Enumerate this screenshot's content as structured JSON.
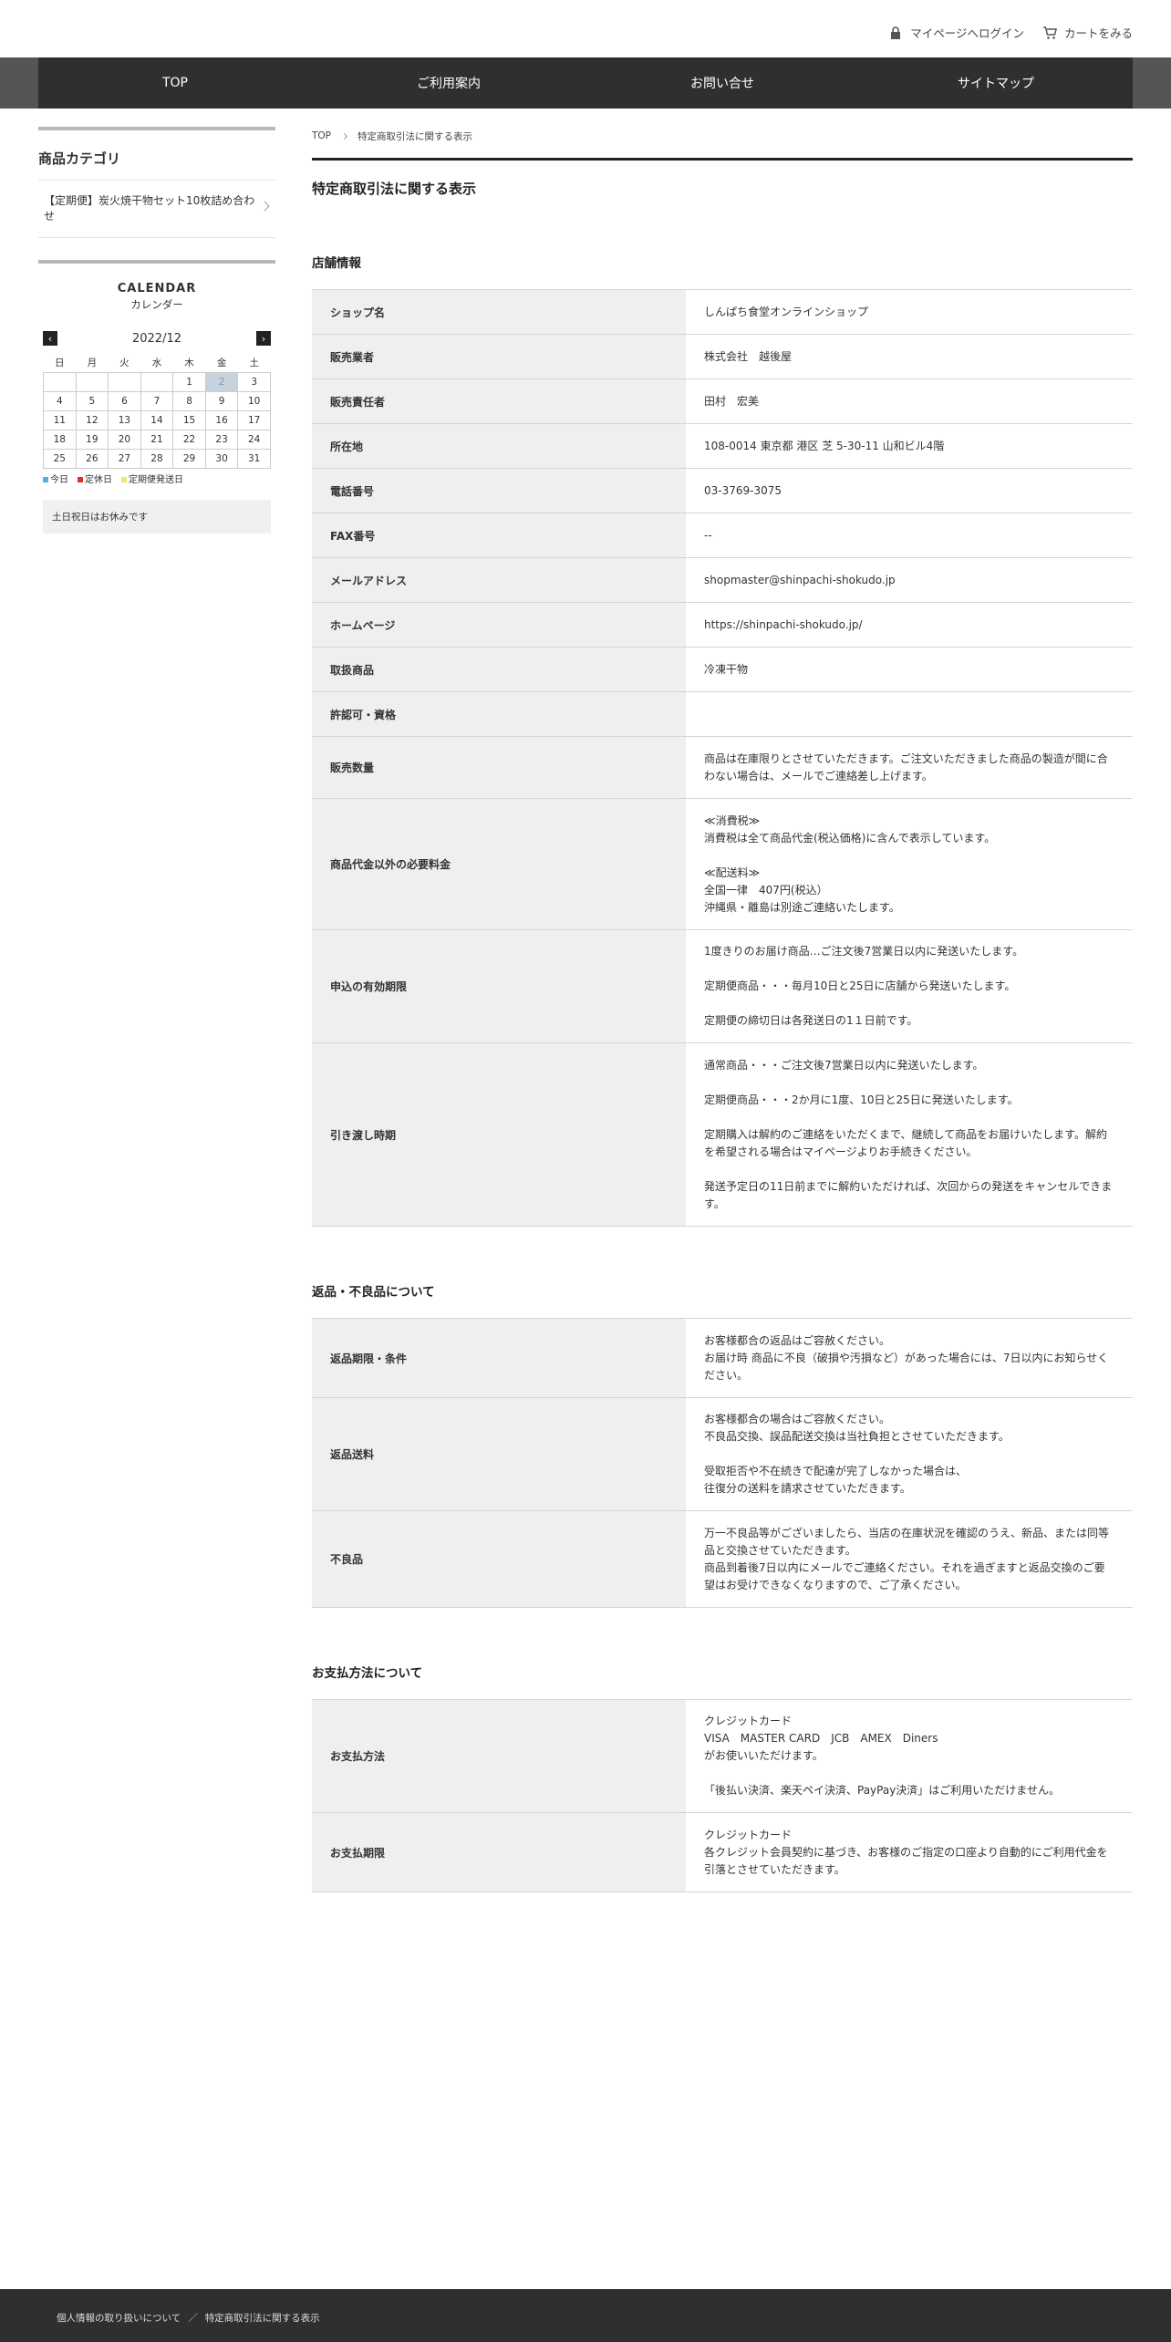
{
  "header": {
    "mypage_label": "マイページへログイン",
    "cart_label": "カートをみる"
  },
  "nav": [
    "TOP",
    "ご利用案内",
    "お問い合せ",
    "サイトマップ"
  ],
  "sidebar": {
    "category_title": "商品カテゴリ",
    "category_item": "【定期便】炭火焼干物セット10枚詰め合わせ",
    "calendar_title": "CALENDAR",
    "calendar_subtitle": "カレンダー",
    "calendar_month": "2022/12",
    "prev_symbol": "‹",
    "next_symbol": "›",
    "weekdays": [
      "日",
      "月",
      "火",
      "水",
      "木",
      "金",
      "土"
    ],
    "weeks": [
      [
        "",
        "",
        "",
        "",
        "1",
        "2",
        "3"
      ],
      [
        "4",
        "5",
        "6",
        "7",
        "8",
        "9",
        "10"
      ],
      [
        "11",
        "12",
        "13",
        "14",
        "15",
        "16",
        "17"
      ],
      [
        "18",
        "19",
        "20",
        "21",
        "22",
        "23",
        "24"
      ],
      [
        "25",
        "26",
        "27",
        "28",
        "29",
        "30",
        "31"
      ]
    ],
    "today": "2",
    "legend": [
      {
        "label": "今日",
        "color": "#4fb3e0"
      },
      {
        "label": "定休日",
        "color": "#e0302a"
      },
      {
        "label": "定期便発送日",
        "color": "#f3e86a"
      }
    ],
    "note": "土日祝日はお休みです"
  },
  "breadcrumb": [
    "TOP",
    "特定商取引法に関する表示"
  ],
  "page_title": "特定商取引法に関する表示",
  "sections": [
    {
      "title": "店舗情報",
      "rows": [
        {
          "label": "ショップ名",
          "value": "しんぱち食堂オンラインショップ"
        },
        {
          "label": "販売業者",
          "value": "株式会社　越後屋"
        },
        {
          "label": "販売責任者",
          "value": "田村　宏美"
        },
        {
          "label": "所在地",
          "value": "108-0014 東京都 港区 芝 5-30-11 山和ビル4階"
        },
        {
          "label": "電話番号",
          "value": "03-3769-3075"
        },
        {
          "label": "FAX番号",
          "value": "--"
        },
        {
          "label": "メールアドレス",
          "value": "shopmaster@shinpachi-shokudo.jp"
        },
        {
          "label": "ホームページ",
          "value": "https://shinpachi-shokudo.jp/"
        },
        {
          "label": "取扱商品",
          "value": "冷凍干物"
        },
        {
          "label": "許認可・資格",
          "value": ""
        },
        {
          "label": "販売数量",
          "value": "商品は在庫限りとさせていただきます。ご注文いただきました商品の製造が間に合わない場合は、メールでご連絡差し上げます。"
        },
        {
          "label": "商品代金以外の必要料金",
          "value": "≪消費税≫\n消費税は全て商品代金(税込価格)に含んで表示しています。\n\n≪配送料≫\n全国一律　407円(税込）\n沖縄県・離島は別途ご連絡いたします。"
        },
        {
          "label": "申込の有効期限",
          "value": "1度きりのお届け商品…ご注文後7営業日以内に発送いたします。\n\n定期便商品・・・毎月10日と25日に店舗から発送いたします。\n\n定期便の締切日は各発送日の1１日前です。"
        },
        {
          "label": "引き渡し時期",
          "value": "通常商品・・・ご注文後7営業日以内に発送いたします。\n\n定期便商品・・・2か月に1度、10日と25日に発送いたします。\n\n定期購入は解約のご連絡をいただくまで、継続して商品をお届けいたします。解約を希望される場合はマイページよりお手続きください。\n\n発送予定日の11日前までに解約いただければ、次回からの発送をキャンセルできます。"
        }
      ]
    },
    {
      "title": "返品・不良品について",
      "rows": [
        {
          "label": "返品期限・条件",
          "value": "お客様都合の返品はご容赦ください。\nお届け時 商品に不良（破損や汚損など）があった場合には、7日以内にお知らせください。"
        },
        {
          "label": "返品送料",
          "value": "お客様都合の場合はご容赦ください。\n不良品交換、誤品配送交換は当社負担とさせていただきます。\n\n受取拒否や不在続きで配達が完了しなかった場合は、\n往復分の送料を請求させていただきます。"
        },
        {
          "label": "不良品",
          "value": "万一不良品等がございましたら、当店の在庫状況を確認のうえ、新品、または同等品と交換させていただきます。\n商品到着後7日以内にメールでご連絡ください。それを過ぎますと返品交換のご要望はお受けできなくなりますので、ご了承ください。"
        }
      ]
    },
    {
      "title": "お支払方法について",
      "rows": [
        {
          "label": "お支払方法",
          "value": "クレジットカード\nVISA　MASTER CARD　JCB　AMEX　Diners\nがお使いいただけます。\n\n「後払い決済、楽天ペイ決済、PayPay決済」はご利用いただけません。"
        },
        {
          "label": "お支払期限",
          "value": "クレジットカード\n各クレジット会員契約に基づき、お客様のご指定の口座より自動的にご利用代金を引落とさせていただきます。"
        }
      ]
    }
  ],
  "footer": {
    "links": [
      "個人情報の取り扱いについて",
      "特定商取引法に関する表示"
    ],
    "separator": "／"
  }
}
